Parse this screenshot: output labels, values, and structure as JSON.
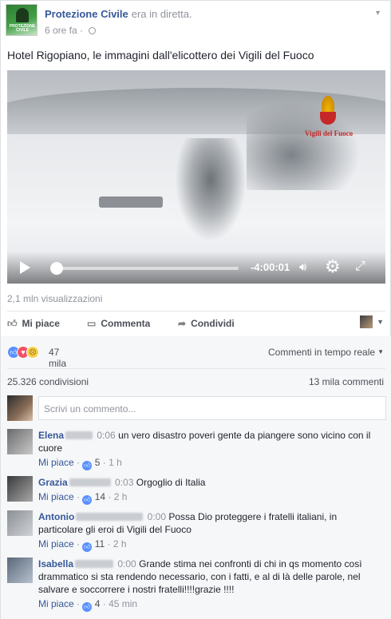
{
  "header": {
    "page_name": "Protezione Civile",
    "status": "era in diretta.",
    "time": "6 ore fa",
    "avatar_text": "PROTEZIONE CIVILE"
  },
  "post": {
    "text": "Hotel Rigopiano, le immagini dall'elicottero dei Vigili del Fuoco"
  },
  "video": {
    "watermark": "Vigili del Fuoco",
    "time_remaining": "-4:00:01",
    "progress_fraction": 0.03
  },
  "views": "2,1 mln visualizzazioni",
  "actions": {
    "like": "Mi piace",
    "comment": "Commenta",
    "share": "Condividi"
  },
  "reactions": {
    "count": "47 mila",
    "live_comments_label": "Commenti in tempo reale"
  },
  "stats": {
    "shares": "25.326 condivisioni",
    "comments": "13 mila commenti"
  },
  "compose": {
    "placeholder": "Scrivi un commento..."
  },
  "comments": [
    {
      "name": "Elena",
      "timestamp": "0:06",
      "text": "un vero disastro poveri gente da piangere sono vicino con il cuore",
      "like_label": "Mi piace",
      "likes": "5",
      "age": "1 h"
    },
    {
      "name": "Grazia",
      "timestamp": "0:03",
      "text": "Orgoglio di Italia",
      "like_label": "Mi piace",
      "likes": "14",
      "age": "2 h"
    },
    {
      "name": "Antonio",
      "timestamp": "0:00",
      "text": "Possa Dio proteggere i fratelli italiani, in particolare gli eroi di Vigili del Fuoco",
      "like_label": "Mi piace",
      "likes": "11",
      "age": "2 h"
    },
    {
      "name": "Isabella",
      "timestamp": "0:00",
      "text": "Grande stima nei confronti di chi in qs momento così drammatico si sta rendendo necessario, con i fatti, e al di là delle parole, nel salvare e soccorrere i nostri fratelli!!!!grazie !!!!",
      "like_label": "Mi piace",
      "likes": "4",
      "age": "45 min"
    }
  ],
  "colors": {
    "link_blue": "#365899",
    "like_blue": "#5890ff",
    "love_red": "#f25268",
    "sad_yellow": "#f7d14c"
  }
}
